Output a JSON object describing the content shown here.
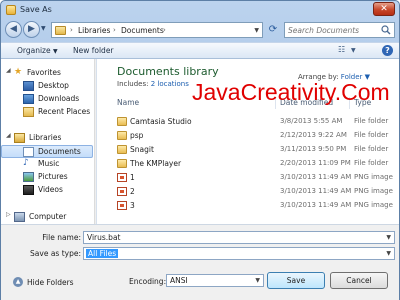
{
  "window": {
    "title": "Save As",
    "close_label": "✕"
  },
  "nav": {
    "breadcrumb": [
      "Libraries",
      "Documents"
    ],
    "search_placeholder": "Search Documents"
  },
  "toolbar": {
    "organize": "Organize",
    "new_folder": "New folder"
  },
  "sidebar": {
    "favorites": "Favorites",
    "desktop": "Desktop",
    "downloads": "Downloads",
    "recent_places": "Recent Places",
    "libraries": "Libraries",
    "documents": "Documents",
    "music": "Music",
    "pictures": "Pictures",
    "videos": "Videos",
    "computer": "Computer"
  },
  "library": {
    "title": "Documents library",
    "includes_label": "Includes:",
    "includes_link": "2 locations",
    "arrange_label": "Arrange by:",
    "arrange_value": "Folder"
  },
  "columns": {
    "name": "Name",
    "date": "Date modified",
    "type": "Type"
  },
  "files": [
    {
      "name": "Camtasia Studio",
      "date": "3/8/2013 5:55 AM",
      "type": "File folder",
      "kind": "folder"
    },
    {
      "name": "psp",
      "date": "2/12/2013 9:22 AM",
      "type": "File folder",
      "kind": "folder"
    },
    {
      "name": "Snagit",
      "date": "3/11/2013 9:50 PM",
      "type": "File folder",
      "kind": "folder"
    },
    {
      "name": "The KMPlayer",
      "date": "2/20/2013 11:09 PM",
      "type": "File folder",
      "kind": "folder"
    },
    {
      "name": "1",
      "date": "3/10/2013 11:49 AM",
      "type": "PNG image",
      "kind": "png"
    },
    {
      "name": "2",
      "date": "3/10/2013 11:49 AM",
      "type": "PNG image",
      "kind": "png"
    },
    {
      "name": "3",
      "date": "3/10/2013 11:49 AM",
      "type": "PNG image",
      "kind": "png"
    }
  ],
  "watermark": "JavaCreativity.Com",
  "form": {
    "file_name_label": "File name:",
    "file_name_value": "Virus.bat",
    "save_type_label": "Save as type:",
    "save_type_value": "All Files"
  },
  "footer": {
    "hide_folders": "Hide Folders",
    "encoding_label": "Encoding:",
    "encoding_value": "ANSI",
    "save": "Save",
    "cancel": "Cancel"
  },
  "colors": {
    "accent": "#1d5b2e",
    "link": "#1d5fb0",
    "watermark": "#e00000",
    "selection": "#3399ff"
  }
}
